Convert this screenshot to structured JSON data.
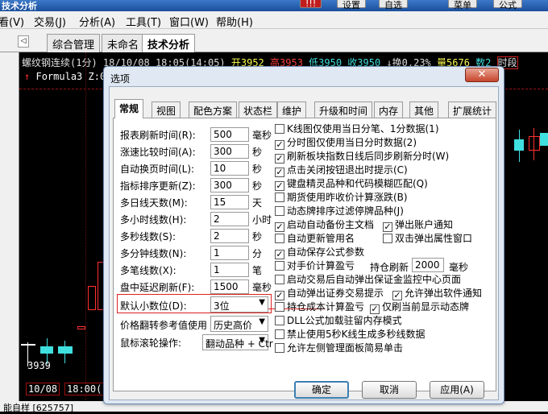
{
  "app": {
    "title": "技术分析",
    "toolbar_buttons": [
      "设置",
      "自选",
      "菜单",
      "公式"
    ]
  },
  "menu": [
    "看(V)",
    "交易(J)",
    "分析(A)",
    "工具(T)",
    "窗口(W)",
    "帮助(H)"
  ],
  "tabs": [
    "综合管理",
    "未命名",
    "技术分析"
  ],
  "chart": {
    "info": {
      "name": "螺纹钢连续(1分)",
      "datetime": "18/10/08 18:05(14:05)",
      "open": "开3952",
      "high": "高3953",
      "low": "低3950",
      "close": "收3950",
      "change": "↓换0.23%",
      "volume": "量5676",
      "pos": "数2",
      "segment": "时段"
    },
    "formula": "Formula3 Z:0",
    "low_price": "3939",
    "dates": [
      "10/08",
      "18:00("
    ],
    "status": "能自样 [625757]"
  },
  "dialog": {
    "title": "选项",
    "close_icon": "close-icon",
    "tabs": [
      "常规",
      "视图",
      "配色方案",
      "状态栏",
      "维护",
      "升级和时间",
      "内存",
      "其他",
      "扩展统计"
    ],
    "active_tab": "常规",
    "fields": [
      {
        "label": "报表刷新时间(R):",
        "value": "500",
        "unit": "毫秒"
      },
      {
        "label": "涨速比较时间(A):",
        "value": "300",
        "unit": "秒"
      },
      {
        "label": "自动换页时间(L):",
        "value": "10",
        "unit": "秒"
      },
      {
        "label": "指标排序更新(Z):",
        "value": "300",
        "unit": "秒"
      },
      {
        "label": "多日线天数(M):",
        "value": "15",
        "unit": "天"
      },
      {
        "label": "多小时线数(H):",
        "value": "2",
        "unit": "小时"
      },
      {
        "label": "多秒线数(S):",
        "value": "2",
        "unit": "秒"
      },
      {
        "label": "多分钟线数(N):",
        "value": "1",
        "unit": "分"
      },
      {
        "label": "多笔线数(X):",
        "value": "1",
        "unit": "笔"
      },
      {
        "label": "盘中延迟刷新(F):",
        "value": "1500",
        "unit": "毫秒"
      }
    ],
    "decimal": {
      "label": "默认小数位(D):",
      "value": "3位"
    },
    "price_ref": {
      "label": "价格翻转参考值使用",
      "value": "历史高价"
    },
    "wheel": {
      "label": "鼠标滚轮操作:",
      "value": "翻动品种 + Ctr"
    },
    "checkboxes": [
      {
        "label": "K线图仅使用当日分笔、1分数据(1)",
        "checked": false
      },
      {
        "label": "分时图仅使用当日分时数据(2)",
        "checked": true
      },
      {
        "label": "刷新板块指数日线后同步刷新分时(W)",
        "checked": true
      },
      {
        "label": "点击关闭按钮退出时提示(C)",
        "checked": true
      },
      {
        "label": "键盘精灵品种和代码模糊匹配(Q)",
        "checked": true
      },
      {
        "label": "期货使用昨收价计算涨跌(B)",
        "checked": false
      },
      {
        "label": "动态牌排序过滤停牌品种(J)",
        "checked": false
      },
      {
        "label": "启动自动备份主文档",
        "checked": true
      },
      {
        "label": "弹出账户通知",
        "checked": true
      },
      {
        "label": "自动更新管用名",
        "checked": false
      },
      {
        "label": "双击弹出属性窗口",
        "checked": false
      },
      {
        "label": "自动保存公式参数",
        "checked": true
      },
      {
        "label": "对手价计算盈亏",
        "checked": false
      },
      {
        "label": "持仓刷新",
        "checked": null
      },
      {
        "label": "启动交易后自动弹出保证金监控中心页面",
        "checked": false
      },
      {
        "label": "自动弹出证券交易提示",
        "checked": true
      },
      {
        "label": "允许弹出软件通知",
        "checked": true
      },
      {
        "label": "持仓成本计算盈亏",
        "checked": false
      },
      {
        "label": "仅刷当前显示动态牌",
        "checked": true
      },
      {
        "label": "DLL公式加载驻留内存模式",
        "checked": false
      },
      {
        "label": "禁止使用5秒K线生成多秒线数据",
        "checked": false
      },
      {
        "label": "允许左侧管理面板简易单击",
        "checked": false
      }
    ],
    "hold_refresh": {
      "value": "2000",
      "unit": "毫秒"
    },
    "buttons": {
      "ok": "确定",
      "cancel": "取消",
      "apply": "应用(A)"
    }
  }
}
